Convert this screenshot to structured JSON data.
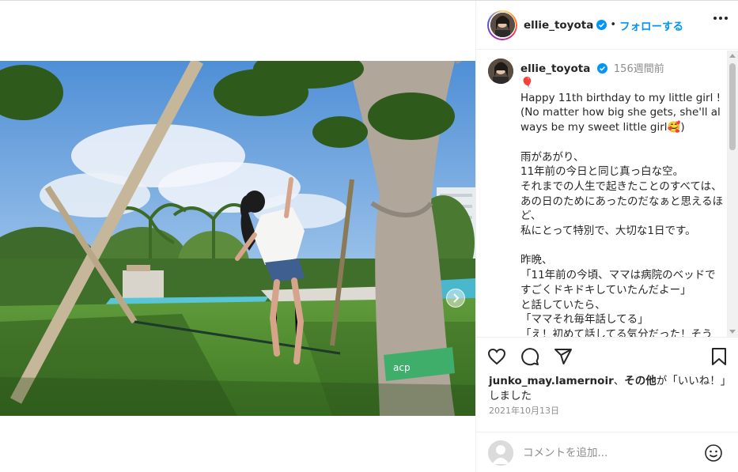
{
  "post": {
    "username": "ellie_toyota",
    "follow_label": "フォローする",
    "separator": "•"
  },
  "caption": {
    "username": "ellie_toyota",
    "time_ago": "156週間前",
    "emoji_line": "🎈",
    "text": "Happy 11th birthday to my little girl !\n(No matter how big she gets, she'll always be my sweet little girl🥰)\n\n雨があがり、\n11年前の今日と同じ真っ白な空。\nそれまでの人生で起きたことのすべては、\nあの日のためにあったのだなぁと思えるほど、\n私にとって特別で、大切な1日です。\n\n昨晩、\n「11年前の今頃、ママは病院のベッドですごくドキドキしていたんだよー」\nと話していたら、\n「ママそれ毎年話してる」\n「え！初めて話してる気分だった！そう"
  },
  "likes": {
    "liker": "junko_may.lamernoir",
    "sep": "、",
    "others": "その他",
    "suffix": "が「いいね！」しました"
  },
  "date": "2021年10月13日",
  "comment_input": {
    "placeholder": "コメントを追加..."
  },
  "icons": {
    "like": "heart-icon",
    "comment": "comment-bubble-icon",
    "share": "paper-plane-icon",
    "save": "bookmark-icon",
    "more": "more-horizontal-icon",
    "verified": "verified-badge-icon",
    "emoji": "smiley-icon",
    "carousel_next": "chevron-right-icon"
  },
  "colors": {
    "accent": "#0095f6",
    "verified": "#0095f6",
    "text": "#262626",
    "secondary": "#8e8e8e",
    "border": "#efefef"
  }
}
